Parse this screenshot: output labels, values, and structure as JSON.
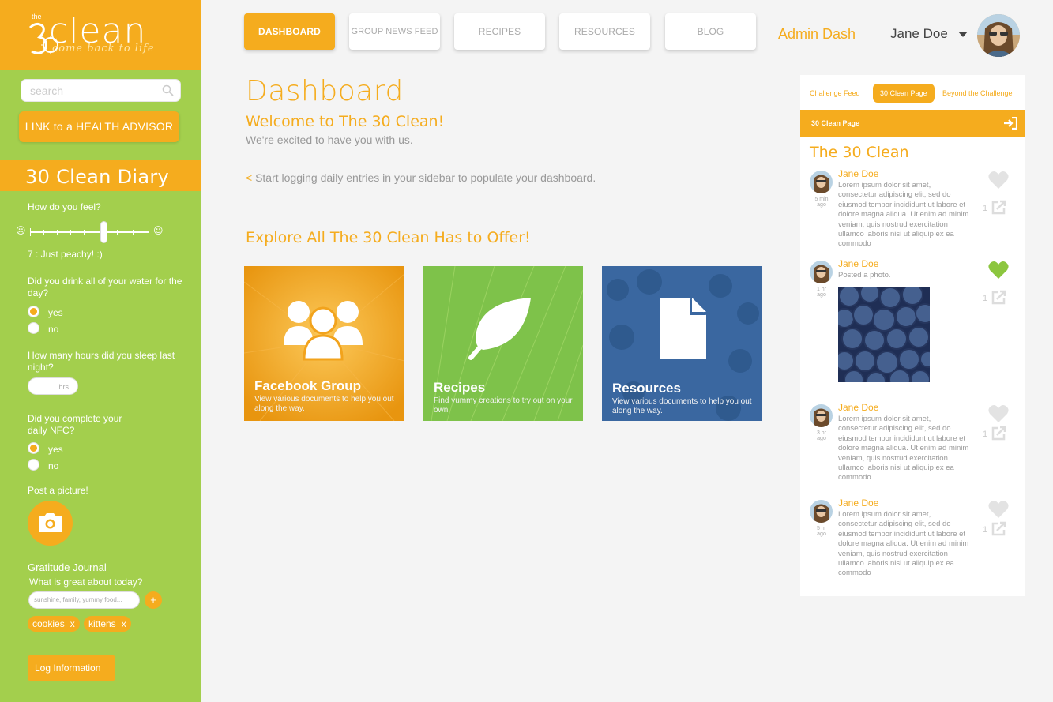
{
  "brand": {
    "the": "the",
    "name": "clean",
    "tagline": "come back to life"
  },
  "colors": {
    "orange": "#f5ac1e",
    "green": "#a3cf4d",
    "liked_heart": "#8cc63f"
  },
  "sidebar": {
    "search_placeholder": "search",
    "health_advisor_button": "LINK to a HEALTH ADVISOR",
    "diary_title": "30 Clean Diary",
    "feel_question": "How do you feel?",
    "feel_value": 7,
    "feel_label": "7 : Just peachy!  :)",
    "water_question": "Did you drink all of your water for the day?",
    "water_options": [
      "yes",
      "no"
    ],
    "water_selected": "yes",
    "sleep_question": "How many hours did you sleep last night?",
    "sleep_unit": "hrs",
    "nfc_question_line1": "Did you complete your",
    "nfc_question_line2": "daily NFC?",
    "nfc_options": [
      "yes",
      "no"
    ],
    "nfc_selected": "yes",
    "picture_label": "Post a picture!",
    "gratitude_title": "Gratitude Journal",
    "gratitude_question": "What is great about today?",
    "gratitude_placeholder": "sunshine, family, yummy food...",
    "gratitude_add": "+",
    "tags": [
      "cookies",
      "kittens"
    ],
    "tag_remove": "x",
    "log_button": "Log Information"
  },
  "nav": {
    "items": [
      "DASHBOARD",
      "GROUP NEWS FEED",
      "RECIPES",
      "RESOURCES",
      "BLOG"
    ],
    "active": "DASHBOARD",
    "admin_link": "Admin Dash",
    "user_name": "Jane Doe"
  },
  "main": {
    "title": "Dashboard",
    "welcome": "Welcome to The 30 Clean!",
    "excited": "We're excited to have you with us.",
    "logging_arrow": "<",
    "logging_text": "Start logging daily entries in your sidebar to populate your dashboard.",
    "explore_title": "Explore All The 30 Clean Has to Offer!",
    "tiles": [
      {
        "title": "Facebook Group",
        "subtitle": "View various documents to help you out along the way.",
        "icon": "group-icon"
      },
      {
        "title": "Recipes",
        "subtitle": "Find yummy creations to try out on your own",
        "icon": "leaf-icon"
      },
      {
        "title": "Resources",
        "subtitle": "View various documents to help you out along the way.",
        "icon": "document-icon"
      }
    ]
  },
  "feed": {
    "tabs": [
      "Challenge Feed",
      "30 Clean Page",
      "Beyond the Challenge"
    ],
    "active_tab": "30 Clean Page",
    "bar_title": "30 Clean Page",
    "title": "The 30 Clean",
    "posts": [
      {
        "name": "Jane Doe",
        "time_line1": "5 min",
        "time_line2": "ago",
        "text": "Lorem ipsum dolor sit amet, consectetur adipiscing elit, sed do eiusmod tempor incididunt ut labore et dolore magna aliqua. Ut enim ad minim veniam, quis nostrud exercitation ullamco laboris nisi ut aliquip ex ea commodo",
        "liked": false,
        "count": "1"
      },
      {
        "name": "Jane Doe",
        "time_line1": "1 hr",
        "time_line2": "ago",
        "text": "Posted a photo.",
        "liked": true,
        "count": "1"
      },
      {
        "name": "Jane Doe",
        "time_line1": "3 hr",
        "time_line2": "ago",
        "text": "Lorem ipsum dolor sit amet, consectetur adipiscing elit, sed do eiusmod tempor incididunt ut labore et dolore magna aliqua. Ut enim ad minim veniam, quis nostrud exercitation ullamco laboris nisi ut aliquip ex ea commodo",
        "liked": false,
        "count": "1"
      },
      {
        "name": "Jane Doe",
        "time_line1": "5 hr",
        "time_line2": "ago",
        "text": "Lorem ipsum dolor sit amet, consectetur adipiscing elit, sed do eiusmod tempor incididunt ut labore et dolore magna aliqua. Ut enim ad minim veniam, quis nostrud exercitation ullamco laboris nisi ut aliquip ex ea commodo",
        "liked": false,
        "count": "1"
      }
    ]
  }
}
